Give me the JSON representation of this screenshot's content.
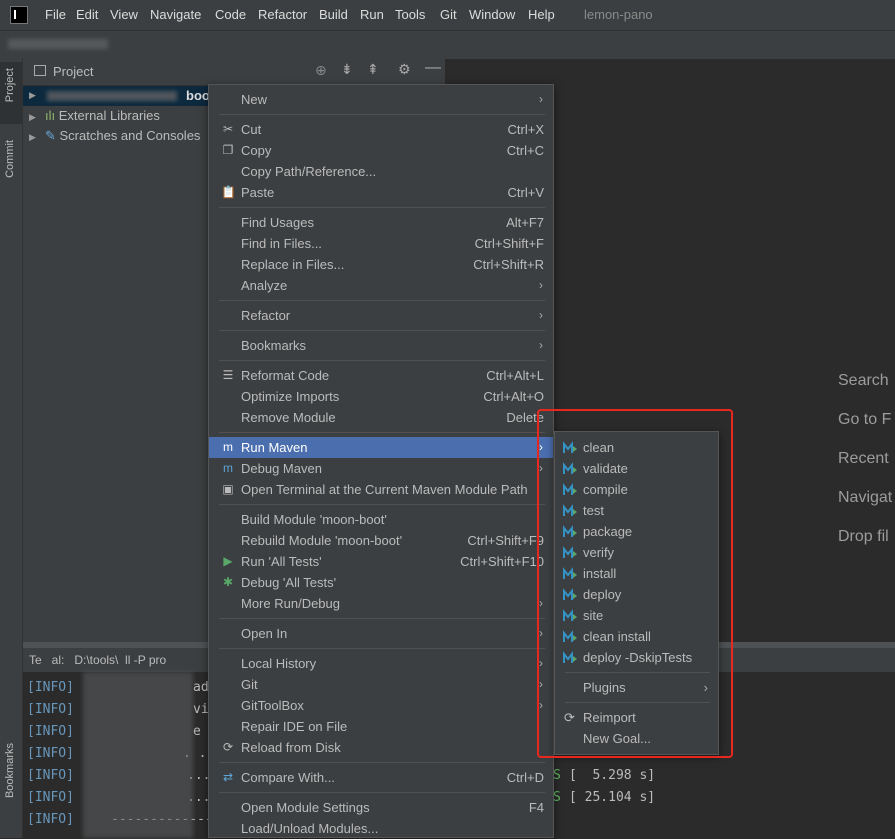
{
  "menubar": {
    "items": [
      "File",
      "Edit",
      "View",
      "Navigate",
      "Code",
      "Refactor",
      "Build",
      "Run",
      "Tools",
      "Git",
      "Window",
      "Help"
    ],
    "project_name": "lemon-pano"
  },
  "left_strip": {
    "project": "Project",
    "commit": "Commit",
    "bookmarks": "Bookmarks"
  },
  "project_panel": {
    "title": "Project",
    "tree": [
      {
        "label": "boo"
      },
      {
        "label": "External Libraries"
      },
      {
        "label": "Scratches and Consoles"
      }
    ]
  },
  "welcome_hints": [
    "Search",
    "Go to F",
    "Recent",
    "Navigat",
    "Drop fil"
  ],
  "terminal": {
    "tab": "Te   al:   D:\\tools\\  ll -P pro",
    "lines": [
      {
        "tag": "[INFO]",
        "tail": "ad"
      },
      {
        "tag": "[INFO]",
        "tail": "vi"
      },
      {
        "tag": "[INFO]",
        "tail": "e"
      },
      {
        "tag": "[INFO]",
        "tail": ". ."
      },
      {
        "tag": "[INFO]",
        "tail": "....",
        "status": "S",
        "time": "[  5.298 s]"
      },
      {
        "tag": "[INFO]",
        "tail": "....",
        "status": "S",
        "time": "[ 25.104 s]"
      },
      {
        "tag": "[INFO]",
        "tail": "--------------------------------------------------------------"
      }
    ]
  },
  "context_menu": {
    "items": [
      {
        "label": "New",
        "shortcut": "",
        "submenu": true
      },
      {
        "label": "Cut",
        "shortcut": "Ctrl+X",
        "icon": "cut-icon"
      },
      {
        "label": "Copy",
        "shortcut": "Ctrl+C",
        "icon": "copy-icon"
      },
      {
        "label": "Copy Path/Reference...",
        "shortcut": ""
      },
      {
        "label": "Paste",
        "shortcut": "Ctrl+V",
        "icon": "paste-icon"
      },
      {
        "label": "Find Usages",
        "shortcut": "Alt+F7"
      },
      {
        "label": "Find in Files...",
        "shortcut": "Ctrl+Shift+F"
      },
      {
        "label": "Replace in Files...",
        "shortcut": "Ctrl+Shift+R"
      },
      {
        "label": "Analyze",
        "shortcut": "",
        "submenu": true
      },
      {
        "label": "Refactor",
        "shortcut": "",
        "submenu": true
      },
      {
        "label": "Bookmarks",
        "shortcut": "",
        "submenu": true
      },
      {
        "label": "Reformat Code",
        "shortcut": "Ctrl+Alt+L",
        "icon": "reformat-icon"
      },
      {
        "label": "Optimize Imports",
        "shortcut": "Ctrl+Alt+O"
      },
      {
        "label": "Remove Module",
        "shortcut": "Delete"
      },
      {
        "label": "Run Maven",
        "shortcut": "",
        "submenu": true,
        "icon": "maven-run-icon",
        "highlighted": true
      },
      {
        "label": "Debug Maven",
        "shortcut": "",
        "submenu": true,
        "icon": "maven-debug-icon"
      },
      {
        "label": "Open Terminal at the Current Maven Module Path",
        "shortcut": "",
        "icon": "terminal-icon"
      },
      {
        "label": "Build Module 'moon-boot'",
        "shortcut": ""
      },
      {
        "label": "Rebuild Module 'moon-boot'",
        "shortcut": "Ctrl+Shift+F9"
      },
      {
        "label": "Run 'All Tests'",
        "shortcut": "Ctrl+Shift+F10",
        "icon": "run-icon"
      },
      {
        "label": "Debug 'All Tests'",
        "shortcut": "",
        "icon": "debug-icon"
      },
      {
        "label": "More Run/Debug",
        "shortcut": "",
        "submenu": true
      },
      {
        "label": "Open In",
        "shortcut": "",
        "submenu": true
      },
      {
        "label": "Local History",
        "shortcut": "",
        "submenu": true
      },
      {
        "label": "Git",
        "shortcut": "",
        "submenu": true
      },
      {
        "label": "GitToolBox",
        "shortcut": "",
        "submenu": true
      },
      {
        "label": "Repair IDE on File",
        "shortcut": ""
      },
      {
        "label": "Reload from Disk",
        "shortcut": "",
        "icon": "reload-icon"
      },
      {
        "label": "Compare With...",
        "shortcut": "Ctrl+D",
        "icon": "compare-icon"
      },
      {
        "label": "Open Module Settings",
        "shortcut": "F4"
      },
      {
        "label": "Load/Unload Modules...",
        "shortcut": ""
      }
    ]
  },
  "run_maven_submenu": {
    "goals": [
      "clean",
      "validate",
      "compile",
      "test",
      "package",
      "verify",
      "install",
      "deploy",
      "site",
      "clean install",
      "deploy -DskipTests"
    ],
    "plugins": "Plugins",
    "reimport": "Reimport",
    "new_goal": "New Goal..."
  },
  "colors": {
    "highlight": "#4b6eaf",
    "annotation": "#e8281f",
    "maven_icon": "#3592c4"
  }
}
